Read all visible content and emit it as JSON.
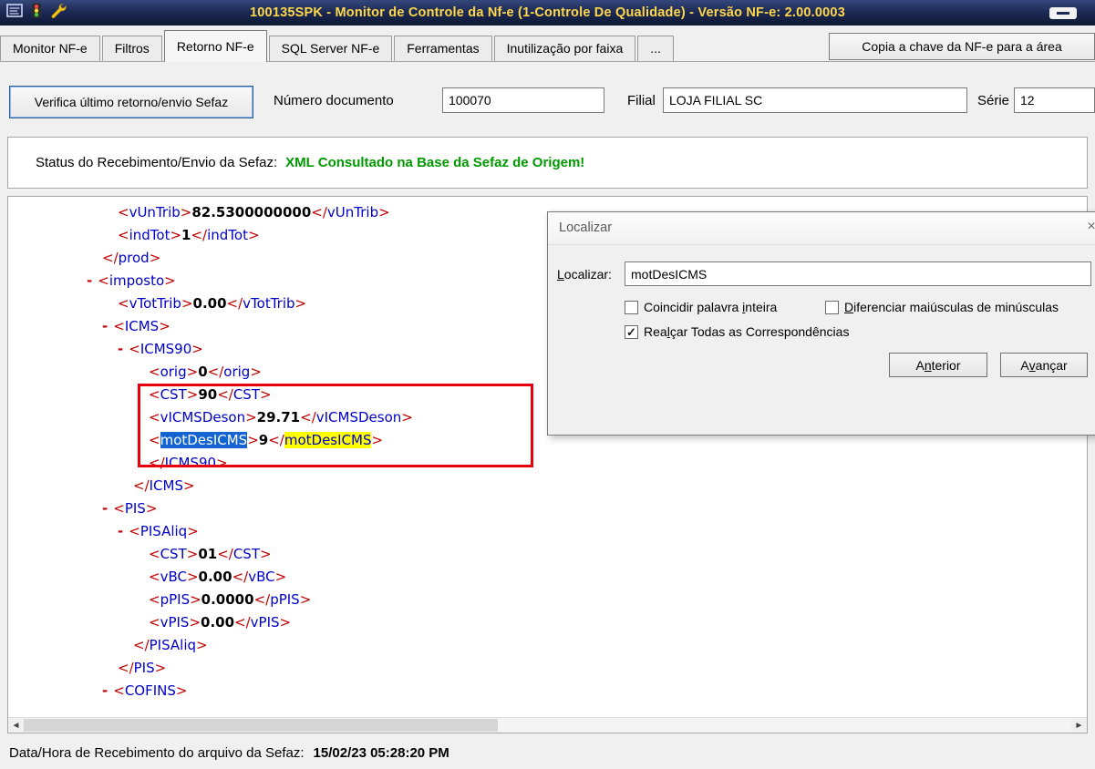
{
  "window": {
    "title": "100135SPK - Monitor de Controle da Nf-e (1-Controle De Qualidade) - Versão NF-e: 2.00.0003"
  },
  "tabs": [
    {
      "label": "Monitor NF-e",
      "active": false
    },
    {
      "label": "Filtros",
      "active": false
    },
    {
      "label": "Retorno NF-e",
      "active": true
    },
    {
      "label": "SQL Server NF-e",
      "active": false
    },
    {
      "label": "Ferramentas",
      "active": false
    },
    {
      "label": "Inutilização por faixa",
      "active": false
    },
    {
      "label": "...",
      "active": false
    }
  ],
  "copy_button": {
    "label": "Copia a chave da NF-e para a área"
  },
  "toolbar": {
    "verify_button": "Verifica último retorno/envio Sefaz",
    "numero": {
      "label": "Número documento",
      "value": "100070"
    },
    "filial": {
      "label": "Filial",
      "value": "LOJA FILIAL SC"
    },
    "serie": {
      "label": "Série",
      "value": "12"
    }
  },
  "status": {
    "label": "Status do Recebimento/Envio da Sefaz:",
    "value": "XML Consultado na Base da Sefaz de Origem!"
  },
  "xml": {
    "lines": [
      {
        "indent": 6,
        "open": "vUnTrib",
        "value": "82.5300000000",
        "close": "vUnTrib"
      },
      {
        "indent": 6,
        "open": "indTot",
        "value": "1",
        "close": "indTot"
      },
      {
        "indent": 5,
        "close": "prod"
      },
      {
        "indent": 4,
        "exp": true,
        "open": "imposto"
      },
      {
        "indent": 6,
        "open": "vTotTrib",
        "value": "0.00",
        "close": "vTotTrib"
      },
      {
        "indent": 5,
        "exp": true,
        "open": "ICMS"
      },
      {
        "indent": 6,
        "exp": true,
        "open": "ICMS90"
      },
      {
        "indent": 8,
        "open": "orig",
        "value": "0",
        "close": "orig"
      },
      {
        "indent": 8,
        "open": "CST",
        "value": "90",
        "close": "CST"
      },
      {
        "indent": 8,
        "open": "vICMSDeson",
        "value": "29.71",
        "close": "vICMSDeson"
      },
      {
        "indent": 8,
        "open": "motDesICMS",
        "value": "9",
        "close": "motDesICMS",
        "openHl": "sel",
        "closeHl": "yel"
      },
      {
        "indent": 8,
        "close": "ICMS90"
      },
      {
        "indent": 7,
        "close": "ICMS"
      },
      {
        "indent": 5,
        "exp": true,
        "open": "PIS"
      },
      {
        "indent": 6,
        "exp": true,
        "open": "PISAliq"
      },
      {
        "indent": 8,
        "open": "CST",
        "value": "01",
        "close": "CST"
      },
      {
        "indent": 8,
        "open": "vBC",
        "value": "0.00",
        "close": "vBC"
      },
      {
        "indent": 8,
        "open": "pPIS",
        "value": "0.0000",
        "close": "pPIS"
      },
      {
        "indent": 8,
        "open": "vPIS",
        "value": "0.00",
        "close": "vPIS"
      },
      {
        "indent": 7,
        "close": "PISAliq"
      },
      {
        "indent": 6,
        "close": "PIS"
      },
      {
        "indent": 5,
        "exp": true,
        "open": "COFINS"
      }
    ]
  },
  "find_dialog": {
    "title": "Localizar",
    "close_icon": "×",
    "field_label": {
      "pre": "",
      "key": "L",
      "post": "ocalizar:"
    },
    "field_value": "motDesICMS",
    "checkboxes": [
      {
        "pre": "Coincidir palavra ",
        "key": "i",
        "post": "nteira",
        "checked": false
      },
      {
        "pre": "",
        "key": "D",
        "post": "iferenciar maiúsculas de minúsculas",
        "checked": false
      },
      {
        "pre": "Rea",
        "key": "l",
        "post": "çar Todas as Correspondências",
        "checked": true
      }
    ],
    "prev_button": {
      "pre": "A",
      "key": "n",
      "post": "terior"
    },
    "next_button": {
      "pre": "A",
      "key": "v",
      "post": "ançar"
    }
  },
  "footer": {
    "label": "Data/Hora de Recebimento do arquivo da Sefaz:",
    "value": "15/02/23 05:28:20 PM"
  },
  "colors": {
    "title_text": "#ffd84a",
    "status_green": "#009a00",
    "highlight_selection": "#1464d2",
    "highlight_yellow": "#ffff00",
    "annotation_red": "#e8000d"
  }
}
